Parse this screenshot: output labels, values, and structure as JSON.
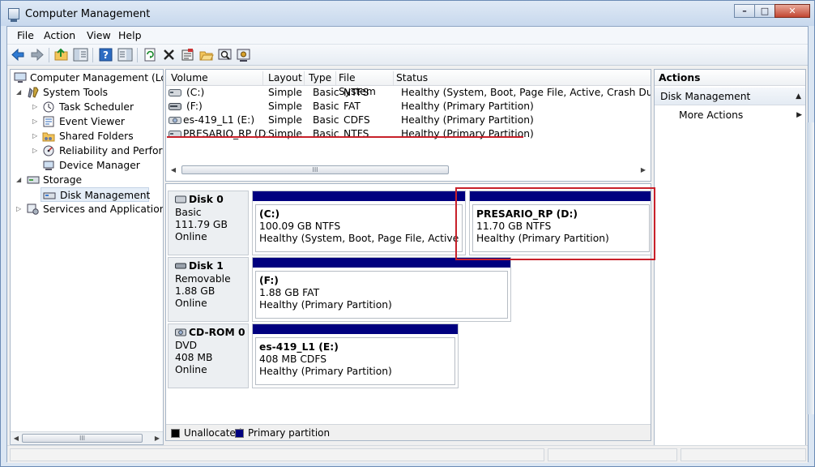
{
  "window": {
    "title": "Computer Management",
    "min": "–",
    "max": "□",
    "close": "✕"
  },
  "menu": [
    "File",
    "Action",
    "View",
    "Help"
  ],
  "toolbar": [
    "back-arrow",
    "forward-arrow",
    "up-folder",
    "show-hide-tree",
    "help",
    "show-hide-action-pane",
    "refresh",
    "delete",
    "properties",
    "open",
    "search",
    "settings"
  ],
  "tree": [
    {
      "label": "Computer Management (Local",
      "icon": "computer-icon",
      "level": 0,
      "expander": ""
    },
    {
      "label": "System Tools",
      "icon": "tools-icon",
      "level": 1,
      "expander": "◢"
    },
    {
      "label": "Task Scheduler",
      "icon": "clock-icon",
      "level": 2,
      "expander": "▷"
    },
    {
      "label": "Event Viewer",
      "icon": "event-viewer-icon",
      "level": 2,
      "expander": "▷"
    },
    {
      "label": "Shared Folders",
      "icon": "shared-folder-icon",
      "level": 2,
      "expander": "▷"
    },
    {
      "label": "Reliability and Performa",
      "icon": "performance-icon",
      "level": 2,
      "expander": "▷"
    },
    {
      "label": "Device Manager",
      "icon": "device-manager-icon",
      "level": 2,
      "expander": ""
    },
    {
      "label": "Storage",
      "icon": "storage-icon",
      "level": 1,
      "expander": "◢"
    },
    {
      "label": "Disk Management",
      "icon": "disk-icon",
      "level": 2,
      "expander": "",
      "selected": true
    },
    {
      "label": "Services and Applications",
      "icon": "services-icon",
      "level": 1,
      "expander": "▷"
    }
  ],
  "scroll": {
    "grip": "III",
    "left": "◀",
    "right": "▶"
  },
  "volumes": {
    "columns": [
      "Volume",
      "Layout",
      "Type",
      "File System",
      "Status"
    ],
    "rows": [
      {
        "volume": "(C:)",
        "layout": "Simple",
        "type": "Basic",
        "fs": "NTFS",
        "status": "Healthy (System, Boot, Page File, Active, Crash Dump, Prim"
      },
      {
        "volume": "(F:)",
        "layout": "Simple",
        "type": "Basic",
        "fs": "FAT",
        "status": "Healthy (Primary Partition)"
      },
      {
        "volume": "es-419_L1 (E:)",
        "layout": "Simple",
        "type": "Basic",
        "fs": "CDFS",
        "status": "Healthy (Primary Partition)"
      },
      {
        "volume": "PRESARIO_RP (D:)",
        "layout": "Simple",
        "type": "Basic",
        "fs": "NTFS",
        "status": "Healthy (Primary Partition)"
      }
    ]
  },
  "disks": [
    {
      "title": "Disk 0",
      "kind": "Basic",
      "size": "111.79 GB",
      "state": "Online",
      "partitions": [
        {
          "name": "(C:)",
          "size": "100.09 GB NTFS",
          "status": "Healthy (System, Boot, Page File, Active, Crash D"
        },
        {
          "name": "PRESARIO_RP  (D:)",
          "size": "11.70 GB NTFS",
          "status": "Healthy (Primary Partition)"
        }
      ]
    },
    {
      "title": "Disk 1",
      "kind": "Removable",
      "size": "1.88 GB",
      "state": "Online",
      "partitions": [
        {
          "name": "(F:)",
          "size": "1.88 GB FAT",
          "status": "Healthy (Primary Partition)"
        }
      ]
    },
    {
      "title": "CD-ROM 0",
      "kind": "DVD",
      "size": "408 MB",
      "state": "Online",
      "partitions": [
        {
          "name": "es-419_L1  (E:)",
          "size": "408 MB CDFS",
          "status": "Healthy (Primary Partition)"
        }
      ]
    }
  ],
  "legend": {
    "unallocated": "Unallocated",
    "primary": "Primary partition",
    "unallocated_color": "#000000",
    "primary_color": "#00007f"
  },
  "actions": {
    "header": "Actions",
    "section": "Disk Management",
    "more": "More Actions",
    "collapse": "▲",
    "more_arrow": "▶"
  },
  "annotation_color": "#c8202a"
}
